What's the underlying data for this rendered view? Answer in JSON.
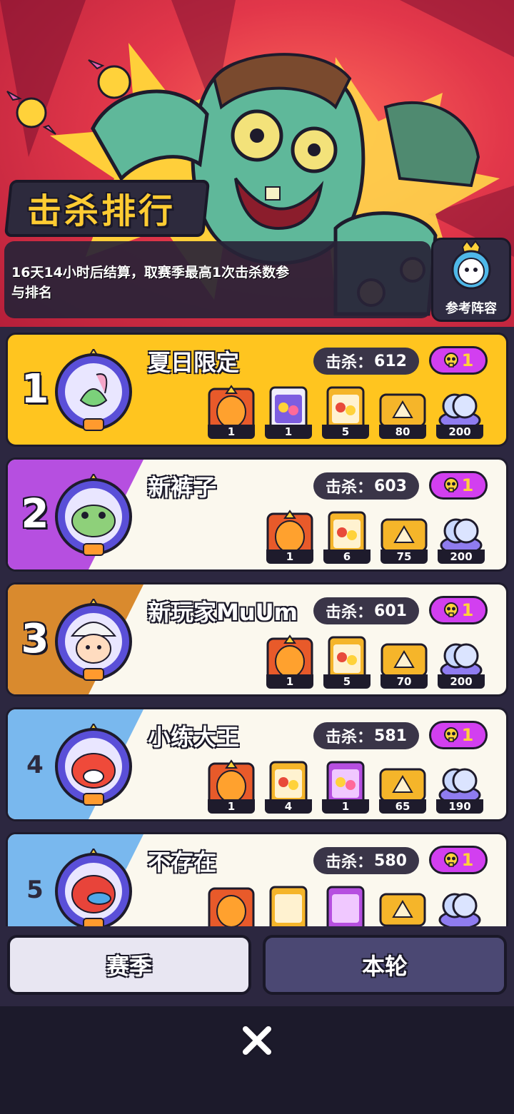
{
  "header": {
    "title": "击杀排行",
    "info_text": "16天14小时后结算，取赛季最高1次击杀数参与排名",
    "lineup_button": "参考阵容"
  },
  "rows": [
    {
      "rank": "1",
      "name": "夏日限定",
      "kill_label": "击杀：",
      "kills": "612",
      "badge": "1",
      "rewards": [
        {
          "icon": "orange-egg-icon",
          "count": "1"
        },
        {
          "icon": "purple-card-pack-icon",
          "count": "1"
        },
        {
          "icon": "gold-card-pack-icon",
          "count": "5"
        },
        {
          "icon": "gold-ticket-icon",
          "count": "80"
        },
        {
          "icon": "blue-token-stack-icon",
          "count": "200"
        }
      ]
    },
    {
      "rank": "2",
      "name": "新裤子",
      "kill_label": "击杀：",
      "kills": "603",
      "badge": "1",
      "rewards": [
        {
          "icon": "orange-egg-icon",
          "count": "1"
        },
        {
          "icon": "gold-card-pack-icon",
          "count": "6"
        },
        {
          "icon": "gold-ticket-icon",
          "count": "75"
        },
        {
          "icon": "blue-token-stack-icon",
          "count": "200"
        }
      ]
    },
    {
      "rank": "3",
      "name": "新玩家MuUm",
      "kill_label": "击杀：",
      "kills": "601",
      "badge": "1",
      "rewards": [
        {
          "icon": "orange-egg-icon",
          "count": "1"
        },
        {
          "icon": "gold-card-pack-icon",
          "count": "5"
        },
        {
          "icon": "gold-ticket-icon",
          "count": "70"
        },
        {
          "icon": "blue-token-stack-icon",
          "count": "200"
        }
      ]
    },
    {
      "rank": "4",
      "name": "小练大王",
      "kill_label": "击杀：",
      "kills": "581",
      "badge": "1",
      "rewards": [
        {
          "icon": "orange-egg-icon",
          "count": "1"
        },
        {
          "icon": "gold-card-pack-icon",
          "count": "4"
        },
        {
          "icon": "purple-card-pack-icon",
          "count": "1"
        },
        {
          "icon": "gold-ticket-icon",
          "count": "65"
        },
        {
          "icon": "blue-token-stack-icon",
          "count": "190"
        }
      ]
    },
    {
      "rank": "5",
      "name": "不存在",
      "kill_label": "击杀：",
      "kills": "580",
      "badge": "1",
      "rewards": [
        {
          "icon": "orange-egg-icon",
          "count": ""
        },
        {
          "icon": "gold-card-pack-icon",
          "count": ""
        },
        {
          "icon": "purple-card-pack-icon",
          "count": ""
        },
        {
          "icon": "gold-ticket-icon",
          "count": ""
        },
        {
          "icon": "blue-token-stack-icon",
          "count": ""
        }
      ]
    }
  ],
  "tabs": {
    "season": "赛季",
    "round": "本轮"
  },
  "colors": {
    "gold_row": "#ffc51f",
    "accent_purple": "#d23ff0",
    "kill_pill": "#3a3548"
  }
}
